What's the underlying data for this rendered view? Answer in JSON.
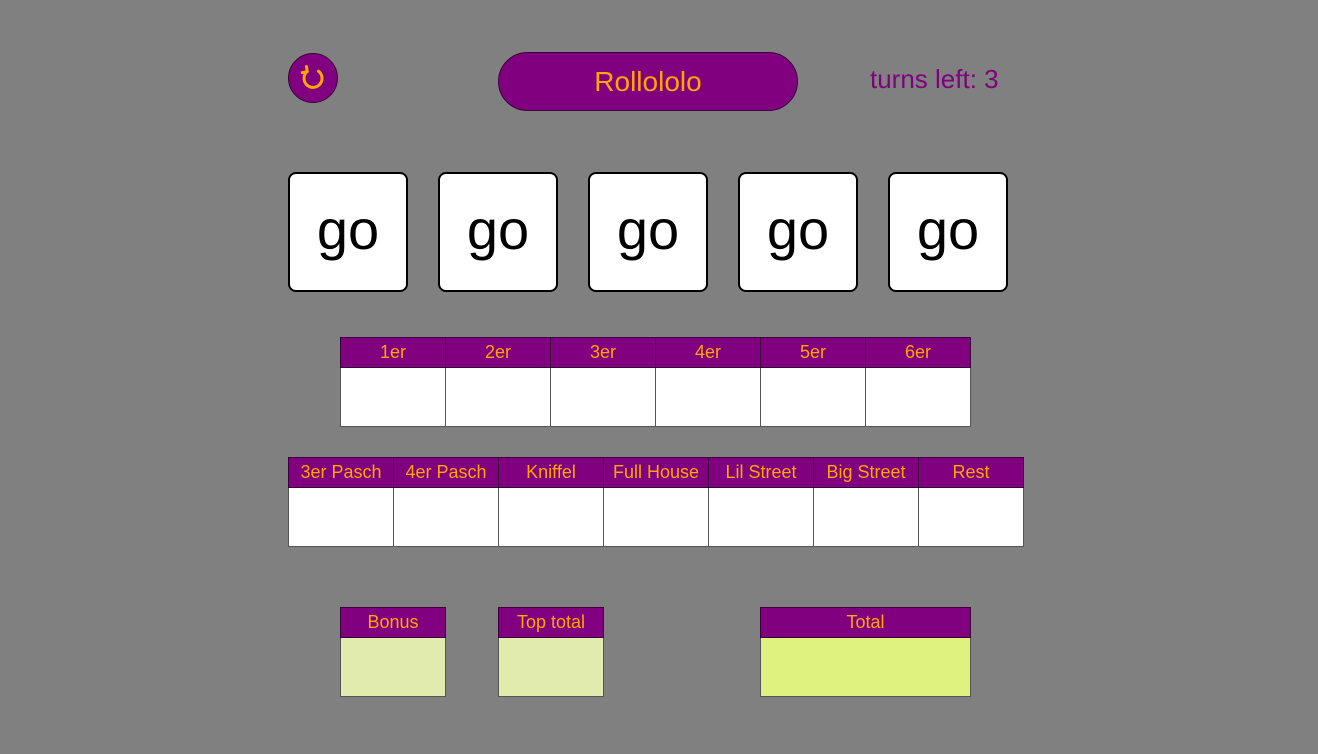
{
  "header": {
    "restart_icon": "restart-icon",
    "title": "Rollololo",
    "turns_label": "turns left: 3"
  },
  "dice": [
    "go",
    "go",
    "go",
    "go",
    "go"
  ],
  "upper_section": {
    "columns": [
      "1er",
      "2er",
      "3er",
      "4er",
      "5er",
      "6er"
    ],
    "values": [
      "",
      "",
      "",
      "",
      "",
      ""
    ]
  },
  "lower_section": {
    "columns": [
      "3er Pasch",
      "4er Pasch",
      "Kniffel",
      "Full House",
      "Lil Street",
      "Big Street",
      "Rest"
    ],
    "values": [
      "",
      "",
      "",
      "",
      "",
      "",
      ""
    ]
  },
  "totals": {
    "bonus": {
      "label": "Bonus",
      "value": ""
    },
    "top_total": {
      "label": "Top total",
      "value": ""
    },
    "total": {
      "label": "Total",
      "value": ""
    }
  },
  "colors": {
    "background": "#808080",
    "accent": "#800080",
    "accent_text": "#ffa500",
    "subtotal_cell": "#e1ebae",
    "total_cell": "#dff17f"
  }
}
